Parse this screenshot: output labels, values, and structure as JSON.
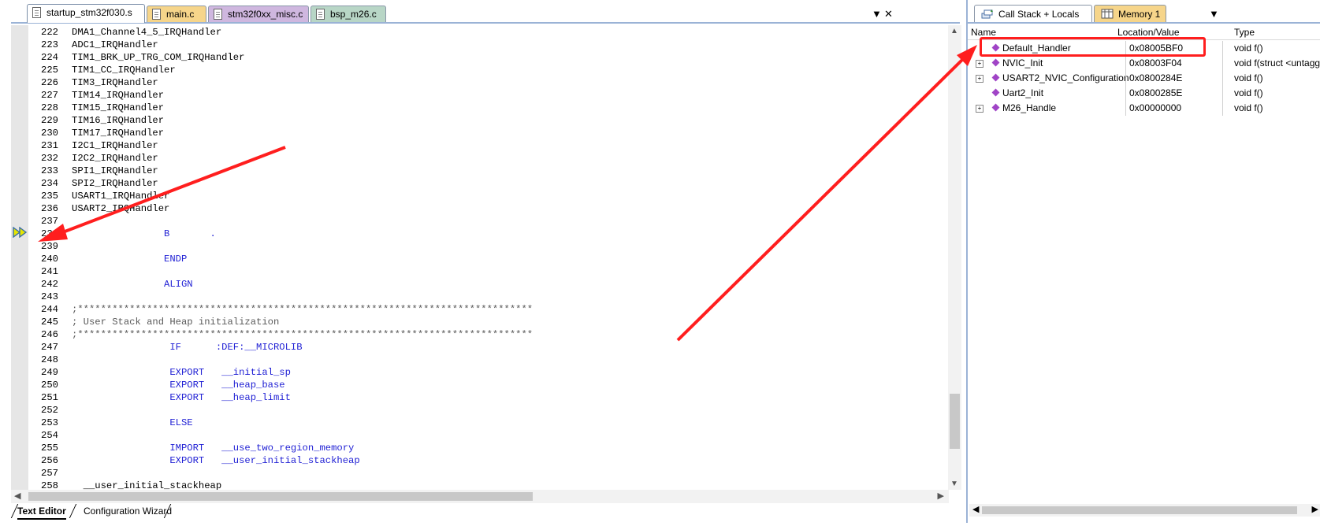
{
  "editor": {
    "tabs": [
      {
        "label": "startup_stm32f030.s"
      },
      {
        "label": "main.c"
      },
      {
        "label": "stm32f0xx_misc.c"
      },
      {
        "label": "bsp_m26.c"
      }
    ],
    "tab_controls": {
      "dropdown": "▼",
      "close": "✕"
    },
    "lines": [
      {
        "num": "222",
        "text": "DMA1_Channel4_5_IRQHandler"
      },
      {
        "num": "223",
        "text": "ADC1_IRQHandler"
      },
      {
        "num": "224",
        "text": "TIM1_BRK_UP_TRG_COM_IRQHandler"
      },
      {
        "num": "225",
        "text": "TIM1_CC_IRQHandler"
      },
      {
        "num": "226",
        "text": "TIM3_IRQHandler"
      },
      {
        "num": "227",
        "text": "TIM14_IRQHandler"
      },
      {
        "num": "228",
        "text": "TIM15_IRQHandler"
      },
      {
        "num": "229",
        "text": "TIM16_IRQHandler"
      },
      {
        "num": "230",
        "text": "TIM17_IRQHandler"
      },
      {
        "num": "231",
        "text": "I2C1_IRQHandler"
      },
      {
        "num": "232",
        "text": "I2C2_IRQHandler"
      },
      {
        "num": "233",
        "text": "SPI1_IRQHandler"
      },
      {
        "num": "234",
        "text": "SPI2_IRQHandler"
      },
      {
        "num": "235",
        "text": "USART1_IRQHandler"
      },
      {
        "num": "236",
        "text": "USART2_IRQHandler"
      },
      {
        "num": "237",
        "text": ""
      },
      {
        "num": "238",
        "text": "                B       ."
      },
      {
        "num": "239",
        "text": ""
      },
      {
        "num": "240",
        "text": "                ENDP"
      },
      {
        "num": "241",
        "text": ""
      },
      {
        "num": "242",
        "text": "                ALIGN"
      },
      {
        "num": "243",
        "text": ""
      },
      {
        "num": "244",
        "text": ";*******************************************************************************"
      },
      {
        "num": "245",
        "text": "; User Stack and Heap initialization"
      },
      {
        "num": "246",
        "text": ";*******************************************************************************"
      },
      {
        "num": "247",
        "text": "                 IF      :DEF:__MICROLIB"
      },
      {
        "num": "248",
        "text": ""
      },
      {
        "num": "249",
        "text": "                 EXPORT   __initial_sp"
      },
      {
        "num": "250",
        "text": "                 EXPORT   __heap_base"
      },
      {
        "num": "251",
        "text": "                 EXPORT   __heap_limit"
      },
      {
        "num": "252",
        "text": ""
      },
      {
        "num": "253",
        "text": "                 ELSE"
      },
      {
        "num": "254",
        "text": ""
      },
      {
        "num": "255",
        "text": "                 IMPORT   __use_two_region_memory"
      },
      {
        "num": "256",
        "text": "                 EXPORT   __user_initial_stackheap"
      },
      {
        "num": "257",
        "text": ""
      },
      {
        "num": "258",
        "text": "  __user_initial_stackheap"
      }
    ],
    "bottom_tabs": [
      "Text Editor",
      "Configuration Wizard"
    ]
  },
  "callstack": {
    "tabs": [
      {
        "label": "Call Stack + Locals"
      },
      {
        "label": "Memory 1"
      }
    ],
    "close": "✕",
    "dropdown": "▼",
    "columns": [
      "Name",
      "Location/Value",
      "Type"
    ],
    "rows": [
      {
        "name": "Default_Handler",
        "location": "0x08005BF0",
        "type": "void f()",
        "expandable": false
      },
      {
        "name": "NVIC_Init",
        "location": "0x08003F04",
        "type": "void f(struct <untagg",
        "expandable": true
      },
      {
        "name": "USART2_NVIC_Configuration",
        "location": "0x0800284E",
        "type": "void f()",
        "expandable": true
      },
      {
        "name": "Uart2_Init",
        "location": "0x0800285E",
        "type": "void f()",
        "expandable": false
      },
      {
        "name": "M26_Handle",
        "location": "0x00000000",
        "type": "void f()",
        "expandable": true
      }
    ]
  },
  "colors": {
    "annotation": "#ff1e1e",
    "keyword": "#1f1fd4",
    "comment": "#5a5a5a"
  }
}
